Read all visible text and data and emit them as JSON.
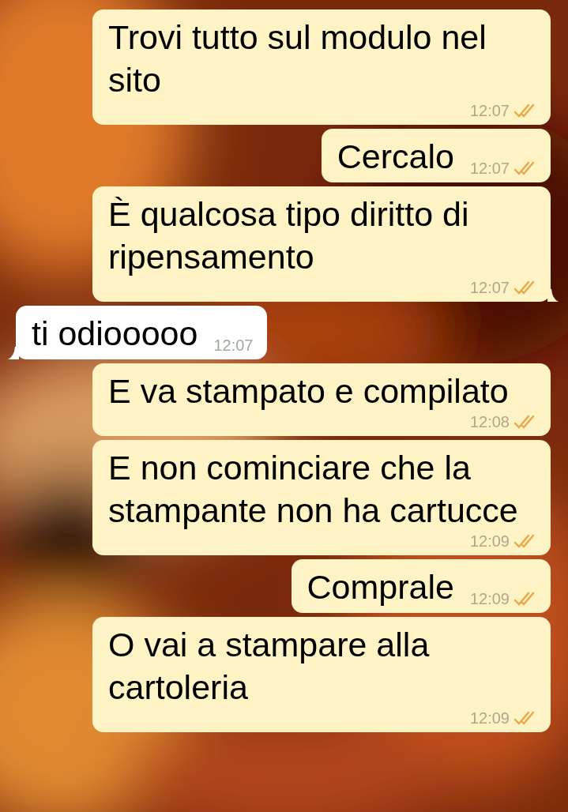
{
  "messages": [
    {
      "kind": "outgoing",
      "text": "Trovi tutto sul modulo nel sito",
      "time": "12:07",
      "tail": false
    },
    {
      "kind": "outgoing",
      "text": "Cercalo",
      "time": "12:07",
      "tail": false
    },
    {
      "kind": "outgoing",
      "text": "È qualcosa tipo diritto di ripensamento",
      "time": "12:07",
      "tail": true
    },
    {
      "kind": "incoming",
      "text": "ti odiooooo",
      "time": "12:07",
      "tail": true
    },
    {
      "kind": "outgoing",
      "text": "E va stampato e compilato",
      "time": "12:08",
      "tail": false
    },
    {
      "kind": "outgoing",
      "text": "E non cominciare che la stampante non ha cartucce",
      "time": "12:09",
      "tail": false
    },
    {
      "kind": "outgoing",
      "text": "Comprale",
      "time": "12:09",
      "tail": false
    },
    {
      "kind": "outgoing",
      "text": "O vai a stampare alla cartoleria",
      "time": "12:09",
      "tail": false
    }
  ]
}
